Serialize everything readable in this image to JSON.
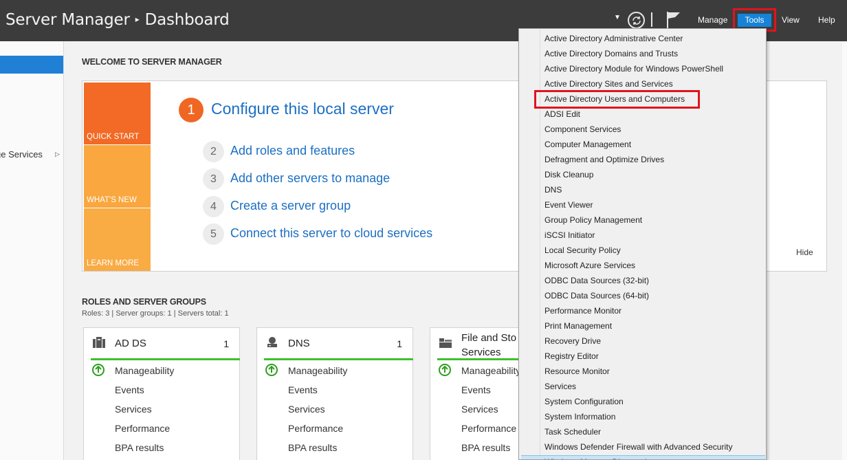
{
  "titlebar": {
    "app": "Server Manager",
    "separator": "▸",
    "page": "Dashboard",
    "menu": {
      "manage": "Manage",
      "tools": "Tools",
      "view": "View",
      "help": "Help"
    }
  },
  "leftnav": {
    "partial_item": "ge Services"
  },
  "welcome": {
    "heading": "WELCOME TO SERVER MANAGER",
    "tiles": [
      "QUICK START",
      "WHAT'S NEW",
      "LEARN MORE"
    ],
    "main_step": {
      "num": "1",
      "label": "Configure this local server"
    },
    "steps": [
      {
        "num": "2",
        "label": "Add roles and features"
      },
      {
        "num": "3",
        "label": "Add other servers to manage"
      },
      {
        "num": "4",
        "label": "Create a server group"
      },
      {
        "num": "5",
        "label": "Connect this server to cloud services"
      }
    ],
    "hide": "Hide"
  },
  "roles": {
    "heading": "ROLES AND SERVER GROUPS",
    "summary": "Roles: 3   |   Server groups: 1   |   Servers total: 1",
    "cards": [
      {
        "title": "AD DS",
        "count": "1",
        "rows": [
          "Manageability",
          "Events",
          "Services",
          "Performance",
          "BPA results"
        ]
      },
      {
        "title": "DNS",
        "count": "1",
        "rows": [
          "Manageability",
          "Events",
          "Services",
          "Performance",
          "BPA results"
        ]
      },
      {
        "title_line1": "File and Sto",
        "title_line2": "Services",
        "rows": [
          "Manageability",
          "Events",
          "Services",
          "Performance",
          "BPA results"
        ]
      }
    ]
  },
  "tools_menu": {
    "items": [
      "Active Directory Administrative Center",
      "Active Directory Domains and Trusts",
      "Active Directory Module for Windows PowerShell",
      "Active Directory Sites and Services",
      "Active Directory Users and Computers",
      "ADSI Edit",
      "Component Services",
      "Computer Management",
      "Defragment and Optimize Drives",
      "Disk Cleanup",
      "DNS",
      "Event Viewer",
      "Group Policy Management",
      "iSCSI Initiator",
      "Local Security Policy",
      "Microsoft Azure Services",
      "ODBC Data Sources (32-bit)",
      "ODBC Data Sources (64-bit)",
      "Performance Monitor",
      "Print Management",
      "Recovery Drive",
      "Registry Editor",
      "Resource Monitor",
      "Services",
      "System Configuration",
      "System Information",
      "Task Scheduler",
      "Windows Defender Firewall with Advanced Security",
      "Windows Memory Diagnostic"
    ],
    "highlighted": "Active Directory Users and Computers"
  },
  "colors": {
    "titlebar_bg": "#3c3c3c",
    "accent_blue": "#1683d8",
    "quick_start": "#f26a25",
    "whats_new": "#f9a73e",
    "learn_more": "#f9ab44",
    "status_green": "#3fbf2e",
    "highlight_red": "#e0141e"
  }
}
